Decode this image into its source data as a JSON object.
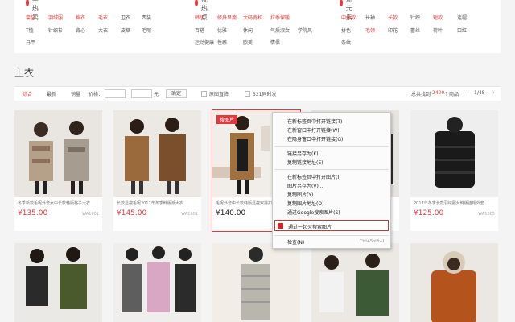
{
  "categories": [
    {
      "title": "当季热卖",
      "tags": [
        {
          "t": "套装",
          "red": true
        },
        {
          "t": "羽绒服",
          "red": true
        },
        {
          "t": "棉衣",
          "red": true
        },
        {
          "t": "毛衣",
          "red": true
        },
        {
          "t": "卫衣",
          "red": false
        },
        {
          "t": "西装",
          "red": false
        },
        {
          "t": "T恤",
          "red": false
        },
        {
          "t": "针织衫",
          "red": false
        },
        {
          "t": "背心",
          "red": false
        },
        {
          "t": "大衣",
          "red": false
        },
        {
          "t": "皮草",
          "red": false
        },
        {
          "t": "毛呢",
          "red": false
        },
        {
          "t": "马甲",
          "red": false
        }
      ]
    },
    {
      "title": "透视热点",
      "tags": [
        {
          "t": "韩版",
          "red": true
        },
        {
          "t": "修身显瘦",
          "red": true
        },
        {
          "t": "大码宽松",
          "red": true
        },
        {
          "t": "拉季保暖",
          "red": true
        },
        {
          "t": "百搭",
          "red": false
        },
        {
          "t": "优雅",
          "red": false
        },
        {
          "t": "休闲",
          "red": false
        },
        {
          "t": "气质淑女",
          "red": false
        },
        {
          "t": "学院风",
          "red": false
        },
        {
          "t": "运动健康",
          "red": false
        },
        {
          "t": "性感",
          "red": false
        },
        {
          "t": "欧美",
          "red": false
        },
        {
          "t": "情侣",
          "red": false
        }
      ]
    },
    {
      "title": "潮流元素",
      "tags": [
        {
          "t": "中长款",
          "red": true
        },
        {
          "t": "长袖",
          "red": false
        },
        {
          "t": "长款",
          "red": true
        },
        {
          "t": "针织",
          "red": false
        },
        {
          "t": "短款",
          "red": true
        },
        {
          "t": "连帽",
          "red": false
        },
        {
          "t": "拼色",
          "red": false
        },
        {
          "t": "毛领",
          "red": true
        },
        {
          "t": "印花",
          "red": false
        },
        {
          "t": "蕾丝",
          "red": false
        },
        {
          "t": "荷叶",
          "red": false
        },
        {
          "t": "口红",
          "red": false
        },
        {
          "t": "条纹",
          "red": false
        }
      ]
    }
  ],
  "section_title": "上衣",
  "filter": {
    "sort_all": "综合",
    "sort_new": "最新",
    "sort_sales": "销量",
    "price_label": "价格：",
    "dash": "-",
    "yuan": "元",
    "confirm": "确定",
    "check_free": "原图直降",
    "check_return": "321同时发",
    "total_prefix": "总共找到",
    "total_count": "2400",
    "total_suffix": "个商品",
    "page": "1/48",
    "prev": "‹",
    "next": "›"
  },
  "products_row1": [
    {
      "name": "冬季新款毛呢外套女中长款韩版格子大衣",
      "price": "¥135.00",
      "code": "WA1601"
    },
    {
      "name": "长款显瘦毛呢2017年冬季韩版潮大衣",
      "price": "¥145.00",
      "code": "WA1601"
    },
    {
      "name": "毛呢外套中长款韩版显瘦双排扣加厚",
      "price": "¥140.00",
      "code": "",
      "badge": "搜图片"
    },
    {
      "name": "",
      "price": "",
      "code": ""
    },
    {
      "name": "2017年冬季长款羽绒服女韩版连帽外套",
      "price": "¥125.00",
      "code": "WA1605"
    }
  ],
  "context_menu": {
    "items": [
      "在新标签页中打开链接(T)",
      "在新窗口中打开链接(W)",
      "在隐身窗口中打开链接(G)",
      "链接另存为(K)...",
      "复制链接地址(E)",
      "在新标签页中打开图片(I)",
      "图片另存为(V)...",
      "复制图片(Y)",
      "复制图片地址(O)",
      "通过Google搜索图片(S)"
    ],
    "highlight": "通过一起火搜索图片",
    "inspect": "检查(N)",
    "inspect_shortcut": "Ctrl+Shift+I"
  }
}
